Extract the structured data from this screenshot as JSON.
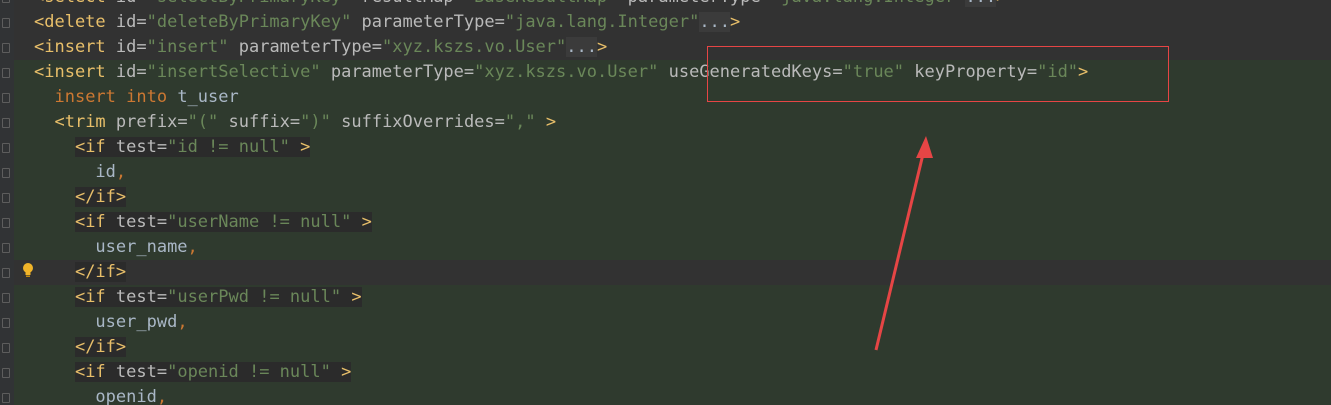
{
  "lines": [
    {
      "indent": "",
      "parts": [
        {
          "c": "t-tag",
          "t": "<select "
        },
        {
          "c": "t-attr",
          "t": "id="
        },
        {
          "c": "t-str",
          "t": "\"selectByPrimaryKey\""
        },
        {
          "c": "t-attr",
          "t": " resultMap="
        },
        {
          "c": "t-str",
          "t": "\"BaseResultMap\""
        },
        {
          "c": "t-attr",
          "t": " parameterType="
        },
        {
          "c": "t-str",
          "t": "\"java.lang.Integer\""
        },
        {
          "c": "t-fold",
          "t": "..."
        },
        {
          "c": "t-tag",
          "t": ">"
        }
      ]
    },
    {
      "indent": "",
      "parts": [
        {
          "c": "t-tag",
          "t": "<delete "
        },
        {
          "c": "t-attr",
          "t": "id="
        },
        {
          "c": "t-str",
          "t": "\"deleteByPrimaryKey\""
        },
        {
          "c": "t-attr",
          "t": " parameterType="
        },
        {
          "c": "t-str",
          "t": "\"java.lang.Integer\""
        },
        {
          "c": "t-fold",
          "t": "..."
        },
        {
          "c": "t-tag",
          "t": ">"
        }
      ]
    },
    {
      "indent": "",
      "parts": [
        {
          "c": "t-tag",
          "t": "<insert "
        },
        {
          "c": "t-attr",
          "t": "id="
        },
        {
          "c": "t-str",
          "t": "\"insert\""
        },
        {
          "c": "t-attr",
          "t": " parameterType="
        },
        {
          "c": "t-str",
          "t": "\"xyz.kszs.vo.User\""
        },
        {
          "c": "t-fold",
          "t": "..."
        },
        {
          "c": "t-tag",
          "t": ">"
        }
      ]
    },
    {
      "indent": "",
      "parts": [
        {
          "c": "t-tag",
          "t": "<insert "
        },
        {
          "c": "t-attr",
          "t": "id="
        },
        {
          "c": "t-str",
          "t": "\"insertSelective\""
        },
        {
          "c": "t-attr",
          "t": " parameterType="
        },
        {
          "c": "t-str",
          "t": "\"xyz.kszs.vo.User\""
        },
        {
          "c": "t-attr",
          "t": " useGeneratedKeys="
        },
        {
          "c": "t-str",
          "t": "\"true\""
        },
        {
          "c": "t-attr",
          "t": " keyProperty="
        },
        {
          "c": "t-str",
          "t": "\"id\""
        },
        {
          "c": "t-tag",
          "t": ">"
        }
      ]
    },
    {
      "indent": "  ",
      "parts": [
        {
          "c": "t-kw",
          "t": "insert into "
        },
        {
          "c": "t-plain",
          "t": "t_user"
        }
      ]
    },
    {
      "indent": "  ",
      "parts": [
        {
          "c": "t-tag",
          "t": "<trim "
        },
        {
          "c": "t-attr",
          "t": "prefix="
        },
        {
          "c": "t-str",
          "t": "\"(\""
        },
        {
          "c": "t-attr",
          "t": " suffix="
        },
        {
          "c": "t-str",
          "t": "\")\""
        },
        {
          "c": "t-attr",
          "t": " suffixOverrides="
        },
        {
          "c": "t-str",
          "t": "\",\""
        },
        {
          "c": "t-tag",
          "t": " >"
        }
      ]
    },
    {
      "indent": "    ",
      "parts": [
        {
          "c": "t-tag",
          "t": "<if "
        },
        {
          "c": "t-attr",
          "t": "test="
        },
        {
          "c": "t-str",
          "t": "\"id != null\""
        },
        {
          "c": "t-tag",
          "t": " >"
        }
      ]
    },
    {
      "indent": "      ",
      "parts": [
        {
          "c": "t-plain",
          "t": "id"
        },
        {
          "c": "t-kw",
          "t": ","
        }
      ]
    },
    {
      "indent": "    ",
      "parts": [
        {
          "c": "t-tag",
          "t": "</if>"
        }
      ]
    },
    {
      "indent": "    ",
      "parts": [
        {
          "c": "t-tag",
          "t": "<if "
        },
        {
          "c": "t-attr",
          "t": "test="
        },
        {
          "c": "t-str",
          "t": "\"userName != null\""
        },
        {
          "c": "t-tag",
          "t": " >"
        }
      ]
    },
    {
      "indent": "      ",
      "parts": [
        {
          "c": "t-plain",
          "t": "user_name"
        },
        {
          "c": "t-kw",
          "t": ","
        }
      ]
    },
    {
      "indent": "    ",
      "parts": [
        {
          "c": "t-tag",
          "t": "</if>"
        }
      ]
    },
    {
      "indent": "    ",
      "parts": [
        {
          "c": "t-tag",
          "t": "<if "
        },
        {
          "c": "t-attr",
          "t": "test="
        },
        {
          "c": "t-str",
          "t": "\"userPwd != null\""
        },
        {
          "c": "t-tag",
          "t": " >"
        }
      ]
    },
    {
      "indent": "      ",
      "parts": [
        {
          "c": "t-plain",
          "t": "user_pwd"
        },
        {
          "c": "t-kw",
          "t": ","
        }
      ]
    },
    {
      "indent": "    ",
      "parts": [
        {
          "c": "t-tag",
          "t": "</if>"
        }
      ]
    },
    {
      "indent": "    ",
      "parts": [
        {
          "c": "t-tag",
          "t": "<if "
        },
        {
          "c": "t-attr",
          "t": "test="
        },
        {
          "c": "t-str",
          "t": "\"openid != null\""
        },
        {
          "c": "t-tag",
          "t": " >"
        }
      ]
    },
    {
      "indent": "      ",
      "parts": [
        {
          "c": "t-plain",
          "t": "openid"
        },
        {
          "c": "t-kw",
          "t": ","
        }
      ]
    }
  ],
  "intention_bulb": "lightbulb-icon",
  "colors": {
    "background": "#2b2b2b",
    "scope_highlight": "#2f3a2e",
    "annotation": "#e64545"
  }
}
